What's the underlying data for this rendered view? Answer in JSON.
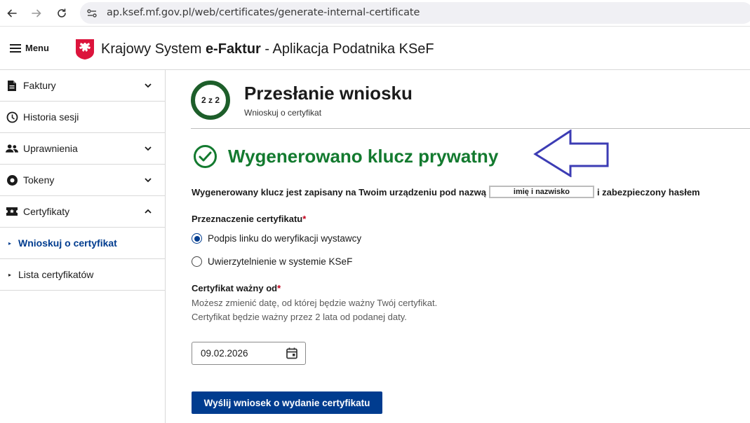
{
  "browser": {
    "url": "ap.ksef.mf.gov.pl/web/certificates/generate-internal-certificate"
  },
  "header": {
    "menu_label": "Menu",
    "title_prefix": "Krajowy System",
    "title_brand": "e-Faktur",
    "title_suffix": " - Aplikacja Podatnika KSeF"
  },
  "sidebar": {
    "items": [
      {
        "label": "Faktury",
        "icon": "document-icon",
        "expandable": true
      },
      {
        "label": "Historia sesji",
        "icon": "clock-icon",
        "expandable": false
      },
      {
        "label": "Uprawnienia",
        "icon": "users-icon",
        "expandable": true
      },
      {
        "label": "Tokeny",
        "icon": "token-icon",
        "expandable": true
      },
      {
        "label": "Certyfikaty",
        "icon": "certificate-icon",
        "expandable": true,
        "expanded": true
      }
    ],
    "subitems": [
      {
        "label": "Wnioskuj o certyfikat",
        "active": true
      },
      {
        "label": "Lista certyfikatów",
        "active": false
      }
    ]
  },
  "main": {
    "step_label": "2 z 2",
    "title": "Przesłanie wniosku",
    "subtitle": "Wnioskuj o certyfikat",
    "success_title": "Wygenerowano klucz prywatny",
    "key_text_before": "Wygenerowany klucz jest zapisany na Twoim urządzeniu pod nazwą",
    "key_name": "imię i nazwisko",
    "key_text_after": "i zabezpieczony hasłem",
    "purpose_label": "Przeznaczenie certyfikatu",
    "required_mark": "*",
    "purpose_options": [
      {
        "label": "Podpis linku do weryfikacji wystawcy",
        "checked": true
      },
      {
        "label": "Uwierzytelnienie w systemie KSeF",
        "checked": false
      }
    ],
    "valid_from_label": "Certyfikat ważny od",
    "valid_from_help": "Możesz zmienić datę, od której będzie ważny Twój certyfikat. Certyfikat będzie ważny przez 2 lata od podanej daty.",
    "valid_from_value": "09.02.2026",
    "submit_label": "Wyślij wniosek o wydanie certyfikatu"
  },
  "colors": {
    "primary": "#003c8f",
    "success": "#137a2f",
    "step_ring": "#1d5e2a",
    "required": "#c4001b",
    "annotation_arrow": "#3c3cb4"
  }
}
